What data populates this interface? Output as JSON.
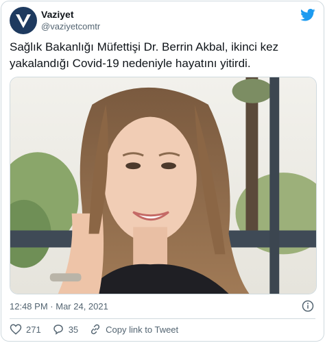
{
  "account": {
    "display_name": "Vaziyet",
    "handle": "@vaziyetcomtr",
    "avatar_icon": "vaziyet-logo-icon"
  },
  "tweet": {
    "text": "Sağlık Bakanlığı Müfettişi Dr. Berrin Akbal, ikinci kez yakalandığı Covid-19 nedeniyle hayatını yitirdi.",
    "time": "12:48 PM",
    "separator": "·",
    "date": "Mar 24, 2021"
  },
  "actions": {
    "likes": "271",
    "replies": "35",
    "copy_link_label": "Copy link to Tweet"
  },
  "colors": {
    "twitter_blue": "#1d9bf0",
    "avatar_bg": "#1e3a5f",
    "muted_text": "#536471",
    "border": "#cfd9de"
  }
}
